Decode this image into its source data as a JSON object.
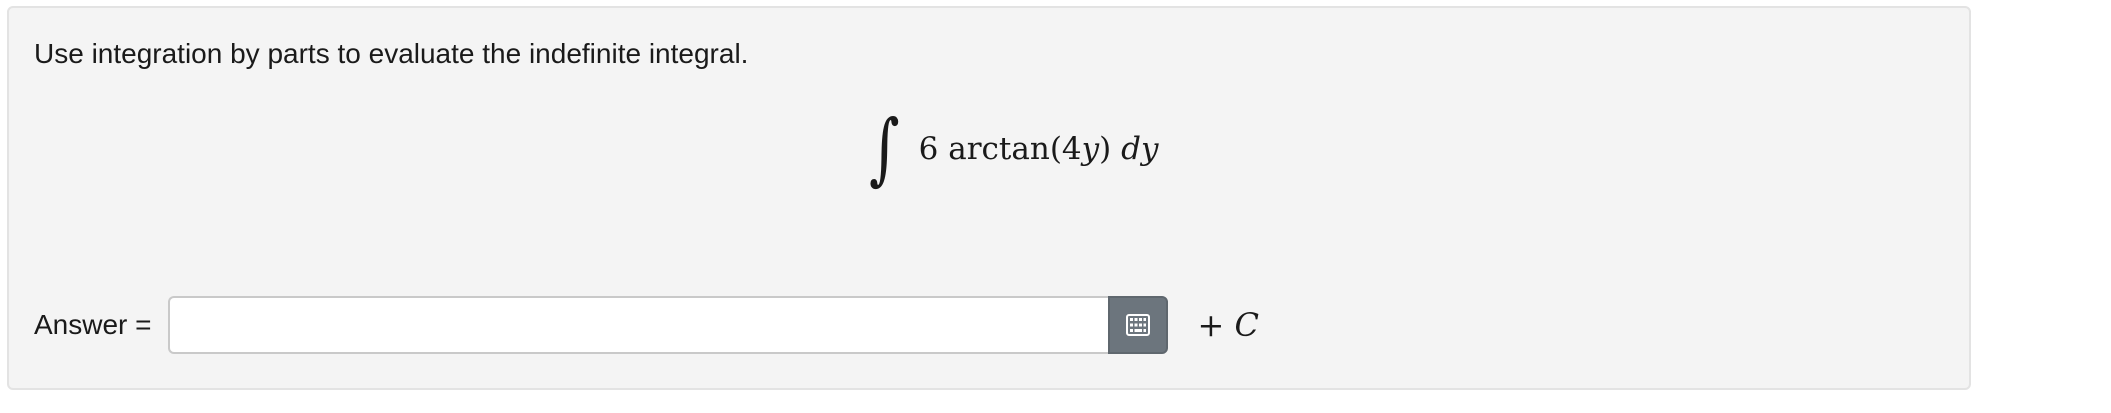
{
  "question": {
    "prompt": "Use integration by parts to evaluate the indefinite integral.",
    "integral": {
      "sign": "∫",
      "coefficient": "6",
      "function": "arctan",
      "open_paren": "(",
      "argument_number": "4",
      "argument_variable": "y",
      "close_paren": ")",
      "differential_d": "d",
      "differential_variable": "y"
    }
  },
  "answer": {
    "label": "Answer =",
    "value": "",
    "placeholder": "",
    "keypad_icon": "keypad-grid-icon",
    "constant_plus": "+",
    "constant_symbol": "C"
  },
  "colors": {
    "card_background": "#f4f4f4",
    "card_border": "#e3e3e3",
    "keypad_button": "#6c757d",
    "text": "#1a1a1a"
  }
}
